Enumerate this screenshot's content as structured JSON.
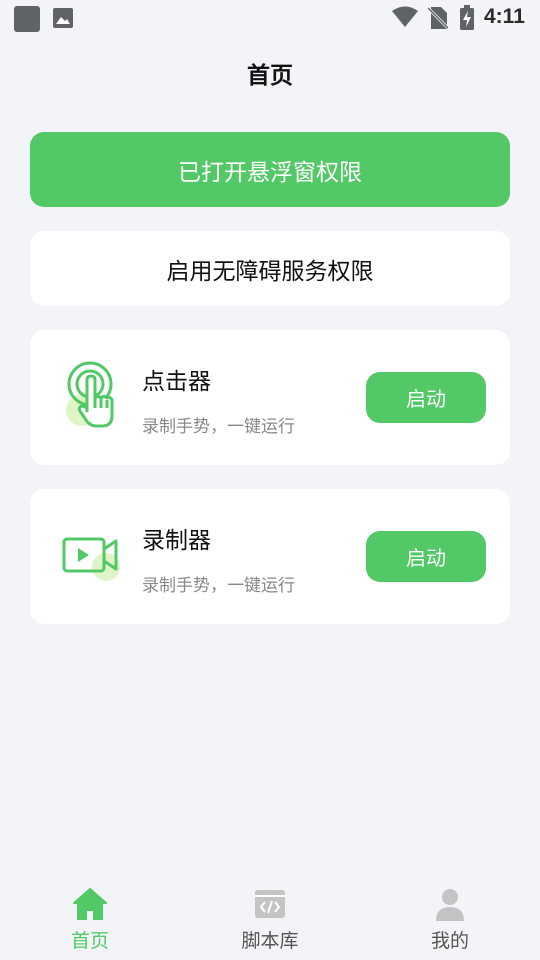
{
  "status_bar": {
    "time": "4:11"
  },
  "header": {
    "title": "首页"
  },
  "permissions": {
    "overlay_label": "已打开悬浮窗权限",
    "accessibility_label": "启用无障碍服务权限"
  },
  "features": [
    {
      "title": "点击器",
      "description": "录制手势，一键运行",
      "button_label": "启动",
      "icon": "tap-gesture-icon"
    },
    {
      "title": "录制器",
      "description": "录制手势，一键运行",
      "button_label": "启动",
      "icon": "video-record-icon"
    }
  ],
  "bottom_nav": {
    "items": [
      {
        "label": "首页",
        "icon": "home-icon",
        "active": true
      },
      {
        "label": "脚本库",
        "icon": "code-folder-icon",
        "active": false
      },
      {
        "label": "我的",
        "icon": "person-icon",
        "active": false
      }
    ]
  },
  "colors": {
    "accent": "#52c866",
    "background": "#f3f4f8",
    "card": "#ffffff",
    "inactive_nav": "#c4c4c4"
  }
}
